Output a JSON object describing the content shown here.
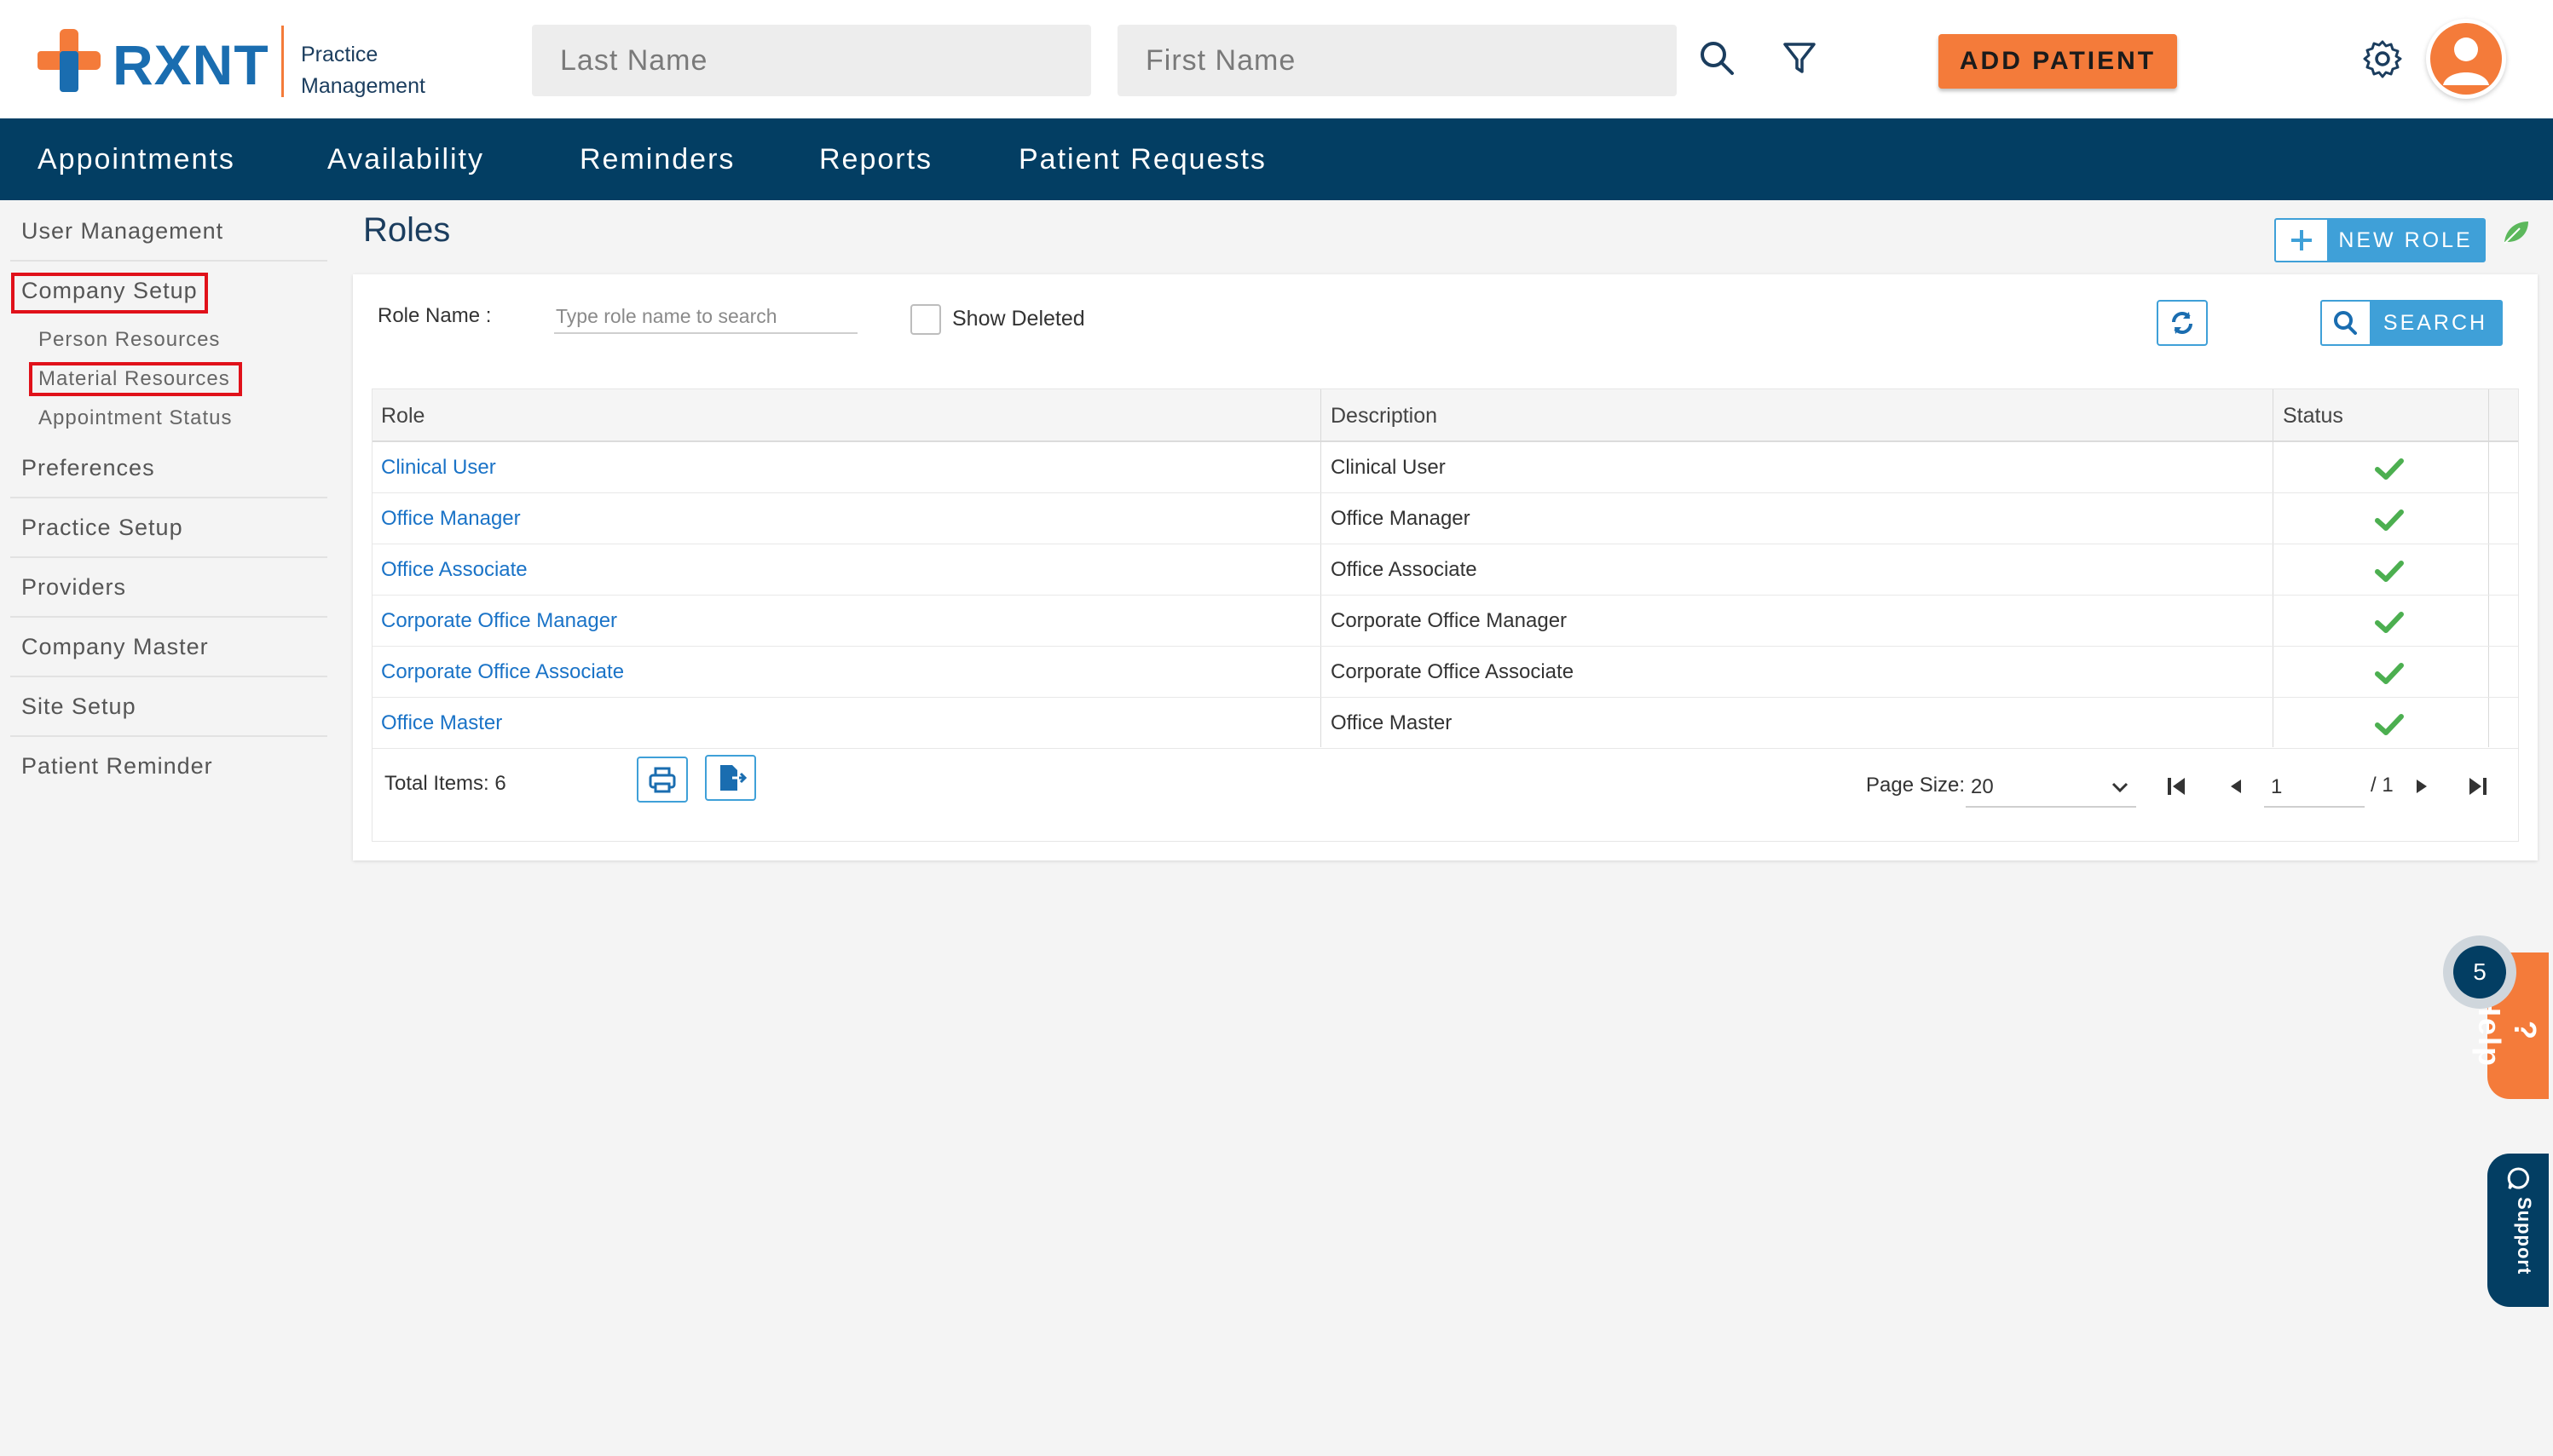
{
  "brand": {
    "name": "RXNT",
    "subtitle_line1": "Practice",
    "subtitle_line2": "Management",
    "accent_color": "#f47b3a",
    "primary_color": "#033e63"
  },
  "header": {
    "last_name_placeholder": "Last Name",
    "first_name_placeholder": "First Name",
    "search_icon": "search-icon",
    "filter_icon": "filter-icon",
    "add_patient_label": "ADD PATIENT",
    "settings_icon": "gear-icon",
    "avatar_icon": "user-avatar-icon"
  },
  "nav": {
    "items": [
      "Appointments",
      "Availability",
      "Reminders",
      "Reports",
      "Patient Requests"
    ]
  },
  "sidebar": {
    "user_management": "User Management",
    "company_setup": "Company Setup",
    "sub_items": [
      "Person Resources",
      "Material Resources",
      "Appointment Status"
    ],
    "items": [
      "Preferences",
      "Practice Setup",
      "Providers",
      "Company Master",
      "Site Setup",
      "Patient Reminder"
    ]
  },
  "main": {
    "title": "Roles",
    "new_role_label": "NEW ROLE",
    "role_name_label": "Role Name :",
    "role_name_placeholder": "Type role name to search",
    "show_deleted_label": "Show Deleted",
    "search_label": "SEARCH",
    "columns": [
      "Role",
      "Description",
      "Status"
    ],
    "rows": [
      {
        "role": "Clinical User",
        "description": "Clinical User",
        "status": "active"
      },
      {
        "role": "Office Manager",
        "description": "Office Manager",
        "status": "active"
      },
      {
        "role": "Office Associate",
        "description": "Office Associate",
        "status": "active"
      },
      {
        "role": "Corporate Office Manager",
        "description": "Corporate Office Manager",
        "status": "active"
      },
      {
        "role": "Corporate Office Associate",
        "description": "Corporate Office Associate",
        "status": "active"
      },
      {
        "role": "Office Master",
        "description": "Office Master",
        "status": "active"
      }
    ],
    "total_items": "Total Items: 6",
    "page_size_label": "Page Size:",
    "page_size_value": "20",
    "current_page": "1",
    "total_pages": "/ 1"
  },
  "widgets": {
    "help_label": "? Help",
    "help_badge": "5",
    "support_label": "Support"
  }
}
